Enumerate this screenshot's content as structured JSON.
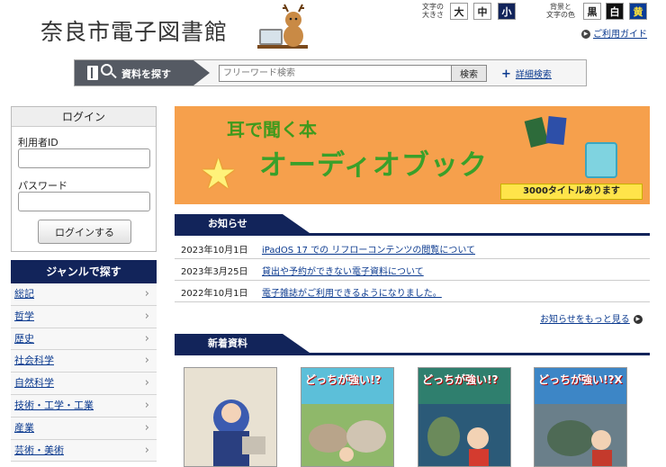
{
  "header": {
    "site_title": "奈良市電子図書館",
    "font_size_label": "文字の\n大きさ",
    "font_sizes": [
      "大",
      "中",
      "小"
    ],
    "bg_color_label": "背景と\n文字の色",
    "color_options": [
      "黒",
      "白",
      "黄"
    ],
    "help_link": "ご利用ガイド"
  },
  "search": {
    "tab_label": "資料を探す",
    "placeholder": "フリーワード検索",
    "button_label": "検索",
    "advanced_link": "詳細検索"
  },
  "login": {
    "title": "ログイン",
    "user_id_label": "利用者ID",
    "password_label": "パスワード",
    "submit_label": "ログインする"
  },
  "genre": {
    "title": "ジャンルで探す",
    "items": [
      "総記",
      "哲学",
      "歴史",
      "社会科学",
      "自然科学",
      "技術・工学・工業",
      "産業",
      "芸術・美術"
    ]
  },
  "banner": {
    "line1": "耳で聞く本",
    "line2": "オーディオブック",
    "tag": "3000タイトルあります"
  },
  "news": {
    "title": "お知らせ",
    "items": [
      {
        "date": "2023年10月1日",
        "title": "iPadOS 17 での リフローコンテンツの閲覧について"
      },
      {
        "date": "2023年3月25日",
        "title": "貸出や予約ができない電子資料について"
      },
      {
        "date": "2022年10月1日",
        "title": "電子雑誌がご利用できるようになりました。"
      }
    ],
    "more_link": "お知らせをもっと見る"
  },
  "new_arrivals": {
    "title": "新着資料",
    "covers": [
      {
        "title": "",
        "color": "#e8e1d2"
      },
      {
        "title": "どっちが強い!?",
        "color": "#5cbfd9"
      },
      {
        "title": "どっちが強い!?",
        "color": "#2f7f6e"
      },
      {
        "title": "どっちが強い!?X",
        "color": "#3d86c6"
      }
    ]
  },
  "colors": {
    "navy": "#12245a",
    "link": "#0b3a8f",
    "banner_orange": "#f6a04c"
  }
}
